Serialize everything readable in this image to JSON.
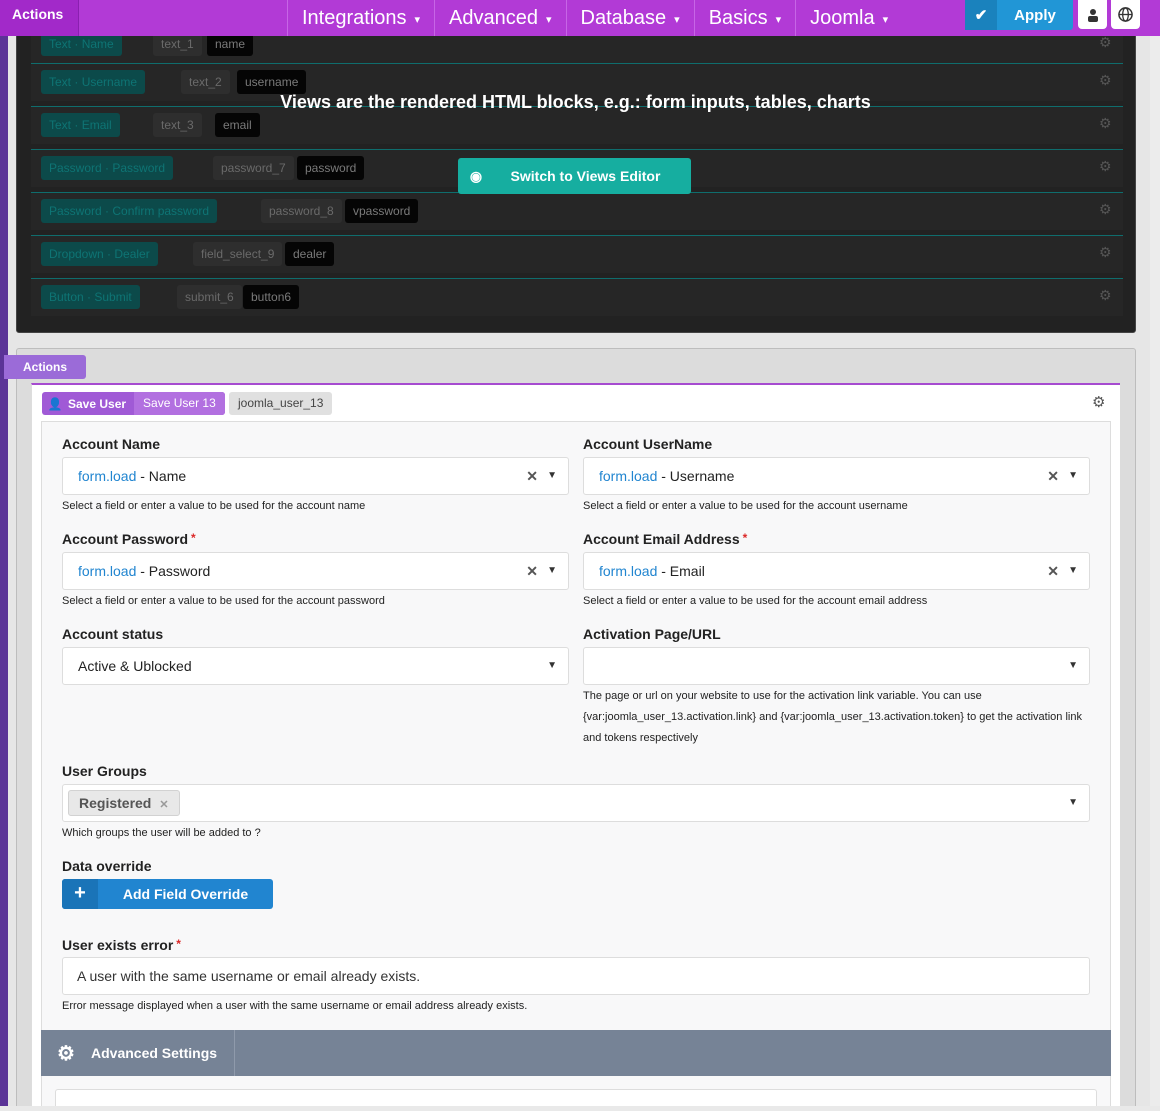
{
  "topbar": {
    "actions_label": "Actions",
    "nav": [
      {
        "label": "Integrations"
      },
      {
        "label": "Advanced"
      },
      {
        "label": "Database"
      },
      {
        "label": "Basics"
      },
      {
        "label": "Joomla"
      }
    ],
    "apply_label": "Apply",
    "icons": [
      "check-icon",
      "user-secret-icon",
      "globe-icon"
    ]
  },
  "views": {
    "rows": [
      {
        "type": "Text",
        "title": "Name",
        "field": "text_1",
        "name": "name"
      },
      {
        "type": "Text",
        "title": "Username",
        "field": "text_2",
        "name": "username"
      },
      {
        "type": "Text",
        "title": "Email",
        "field": "text_3",
        "name": "email"
      },
      {
        "type": "Password",
        "title": "Password",
        "field": "password_7",
        "name": "password"
      },
      {
        "type": "Password",
        "title": "Confirm password",
        "field": "password_8",
        "name": "vpassword"
      },
      {
        "type": "Dropdown",
        "title": "Dealer",
        "field": "field_select_9",
        "name": "dealer"
      },
      {
        "type": "Button",
        "title": "Submit",
        "field": "submit_6",
        "name": "button6"
      }
    ],
    "message": "Views are the rendered HTML blocks, e.g.: form inputs, tables, charts",
    "switch_label": "Switch to Views Editor"
  },
  "actions": {
    "tag": "Actions",
    "chip_type": "Save User",
    "chip_title": "Save User 13",
    "chip_name": "joomla_user_13",
    "fields": {
      "account_name": {
        "label": "Account Name",
        "source": "form.load",
        "value": " - Name",
        "hint": "Select a field or enter a value to be used for the account name"
      },
      "account_username": {
        "label": "Account UserName",
        "source": "form.load",
        "value": " - Username",
        "hint": "Select a field or enter a value to be used for the account username"
      },
      "account_password": {
        "label": "Account Password",
        "required": "*",
        "source": "form.load",
        "value": " - Password",
        "hint": "Select a field or enter a value to be used for the account password"
      },
      "account_email": {
        "label": "Account Email Address",
        "required": "*",
        "source": "form.load",
        "value": " - Email",
        "hint": "Select a field or enter a value to be used for the account email address"
      },
      "account_status": {
        "label": "Account status",
        "value": "Active & Ublocked"
      },
      "activation_page": {
        "label": "Activation Page/URL",
        "value": "",
        "hint_1": "The page or url on your website to use for the activation link variable. You can use",
        "hint_2": "{var:joomla_user_13.activation.link} and {var:joomla_user_13.activation.token} to get the activation link",
        "hint_3": "and tokens respectively"
      },
      "user_groups": {
        "label": "User Groups",
        "selected": "Registered",
        "hint": "Which groups the user will be added to ?"
      },
      "data_override": {
        "label": "Data override",
        "button": "Add Field Override"
      },
      "user_exists_error": {
        "label": "User exists error",
        "required": "*",
        "value": "A user with the same username or email already exists.",
        "hint": "Error message displayed when a user with the same username or email address already exists."
      }
    },
    "advanced_settings": "Advanced Settings"
  }
}
